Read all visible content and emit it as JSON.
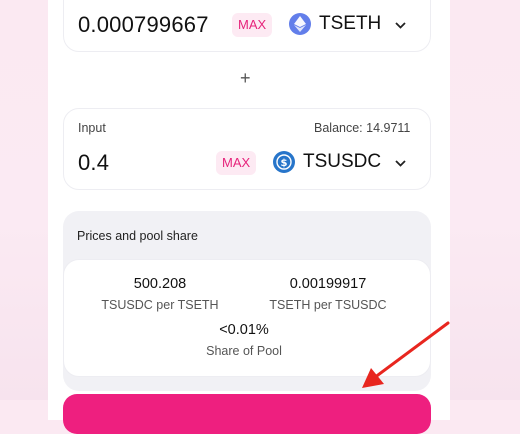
{
  "token_a": {
    "amount": "0.000799667",
    "max_label": "MAX",
    "symbol": "TSETH",
    "icon": "ethereum-icon"
  },
  "plus_sign": "+",
  "token_b": {
    "input_label": "Input",
    "balance": "Balance: 14.9711",
    "amount": "0.4",
    "max_label": "MAX",
    "symbol": "TSUSDC",
    "icon": "usdc-icon"
  },
  "pool": {
    "title": "Prices and pool share",
    "price1_value": "500.208",
    "price1_label": "TSUSDC per TSETH",
    "price2_value": "0.00199917",
    "price2_label": "TSETH per TSUSDC",
    "share_value": "<0.01%",
    "share_label": "Share of Pool"
  },
  "colors": {
    "accent": "#ee1f7f",
    "max_bg": "#fdeaf3",
    "max_text": "#e6247b",
    "arrow": "#e8261f",
    "usdc": "#2775ca",
    "eth": "#627eea"
  }
}
